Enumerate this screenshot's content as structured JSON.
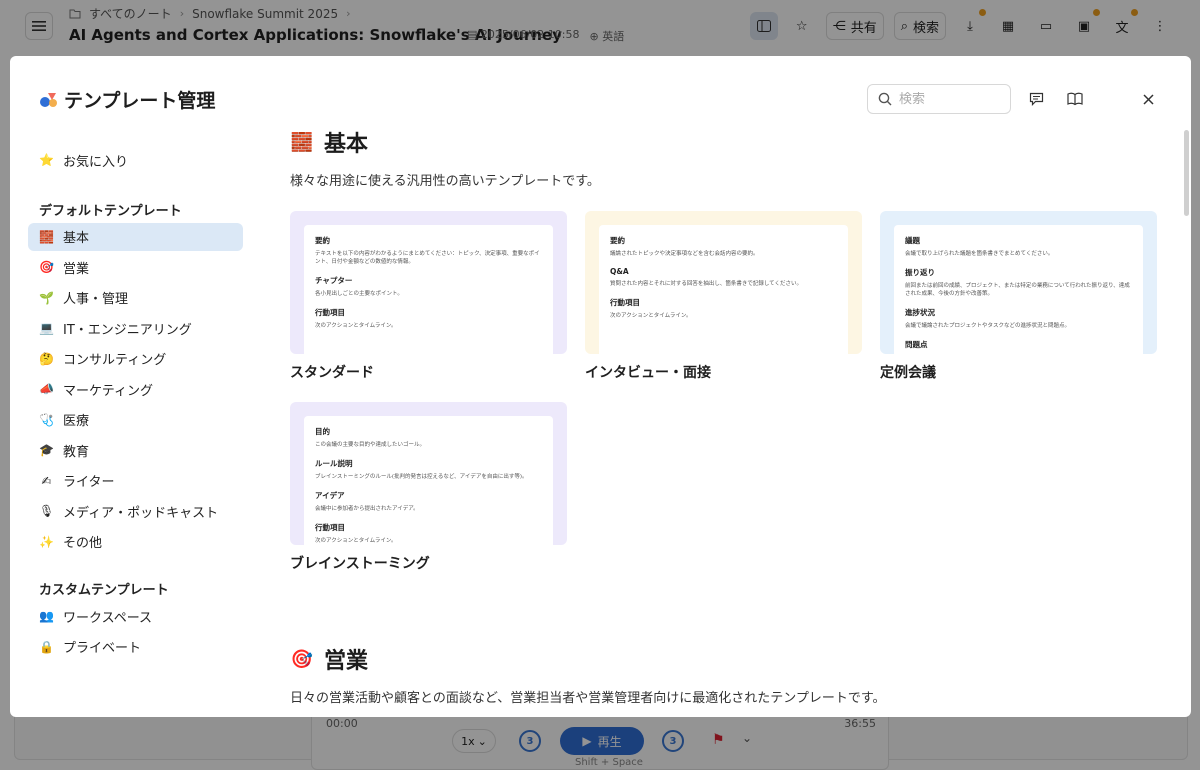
{
  "app": {
    "breadcrumb": [
      "すべてのノート",
      "Snowflake Summit 2025"
    ],
    "note_title": "AI Agents and Cortex Applications: Snowflake's AI Journey",
    "date": "2025/06/02 10:58",
    "language": "英語",
    "toolbar": {
      "share_label": "共有",
      "search_label": "検索"
    },
    "player": {
      "current_time": "00:00",
      "total_time": "36:55",
      "speed": "1x",
      "skip_back": "3",
      "skip_forward": "3",
      "play_label": "再生",
      "shortcut_hint": "Shift + Space"
    }
  },
  "modal": {
    "title": "テンプレート管理",
    "search_placeholder": "検索",
    "sidebar": {
      "favorites": {
        "emoji": "⭐",
        "label": "お気に入り"
      },
      "default_heading": "デフォルトテンプレート",
      "default_items": [
        {
          "emoji": "🧱",
          "label": "基本",
          "active": true
        },
        {
          "emoji": "🎯",
          "label": "営業"
        },
        {
          "emoji": "🌱",
          "label": "人事・管理"
        },
        {
          "emoji": "💻",
          "label": "IT・エンジニアリング"
        },
        {
          "emoji": "🤔",
          "label": "コンサルティング"
        },
        {
          "emoji": "📣",
          "label": "マーケティング"
        },
        {
          "emoji": "🩺",
          "label": "医療"
        },
        {
          "emoji": "🎓",
          "label": "教育"
        },
        {
          "emoji": "✍",
          "label": "ライター"
        },
        {
          "emoji": "🎙",
          "label": "メディア・ポッドキャスト"
        },
        {
          "emoji": "✨",
          "label": "その他"
        }
      ],
      "custom_heading": "カスタムテンプレート",
      "custom_items": [
        {
          "emoji": "👥",
          "label": "ワークスペース"
        },
        {
          "emoji": "🔒",
          "label": "プライベート"
        }
      ]
    },
    "sections": [
      {
        "emoji": "🧱",
        "title": "基本",
        "description": "様々な用途に使える汎用性の高いテンプレートです。",
        "templates": [
          {
            "name": "スタンダード",
            "bg": "#ede9fb",
            "items": [
              {
                "heading": "要約",
                "text": "テキストを以下の内容がわかるようにまとめてください：トピック、決定事項、重要なポイント、日付や金額などの数値的な情報。"
              },
              {
                "heading": "チャプター",
                "text": "各小見出しごとの主要なポイント。"
              },
              {
                "heading": "行動項目",
                "text": "次のアクションとタイムライン。"
              }
            ]
          },
          {
            "name": "インタビュー・面接",
            "bg": "#fdf6e3",
            "items": [
              {
                "heading": "要約",
                "text": "議論されたトピックや決定事項などを含む会話内容の要約。"
              },
              {
                "heading": "Q&A",
                "text": "質問された内容とそれに対する回答を抽出し、箇条書きで記録してください。"
              },
              {
                "heading": "行動項目",
                "text": "次のアクションとタイムライン。"
              }
            ]
          },
          {
            "name": "定例会議",
            "bg": "#e4f0fb",
            "items": [
              {
                "heading": "議題",
                "text": "会議で取り上げられた議題を箇条書きでまとめてください。"
              },
              {
                "heading": "振り返り",
                "text": "前回または前回の成績、プロジェクト、または特定の業務について行われた振り返り、達成された成果、今後の方針や改善策。"
              },
              {
                "heading": "進捗状況",
                "text": "会議で議論されたプロジェクトやタスクなどの進捗状況と問題点。"
              },
              {
                "heading": "問題点",
                "text": ""
              }
            ]
          },
          {
            "name": "ブレインストーミング",
            "bg": "#ede9fb",
            "items": [
              {
                "heading": "目的",
                "text": "この会議の主要な目的や達成したいゴール。"
              },
              {
                "heading": "ルール説明",
                "text": "ブレインストーミングのルール(批判的発言は控えるなど、アイデアを自由に出す等)。"
              },
              {
                "heading": "アイデア",
                "text": "会議中に参加者から提出されたアイデア。"
              },
              {
                "heading": "行動項目",
                "text": "次のアクションとタイムライン。"
              }
            ]
          }
        ]
      },
      {
        "emoji": "🎯",
        "title": "営業",
        "description": "日々の営業活動や顧客との面談など、営業担当者や営業管理者向けに最適化されたテンプレートです。",
        "stub_colors": [
          "#ede9fb",
          "#ede9fb",
          "#e4f0fb"
        ]
      }
    ]
  }
}
